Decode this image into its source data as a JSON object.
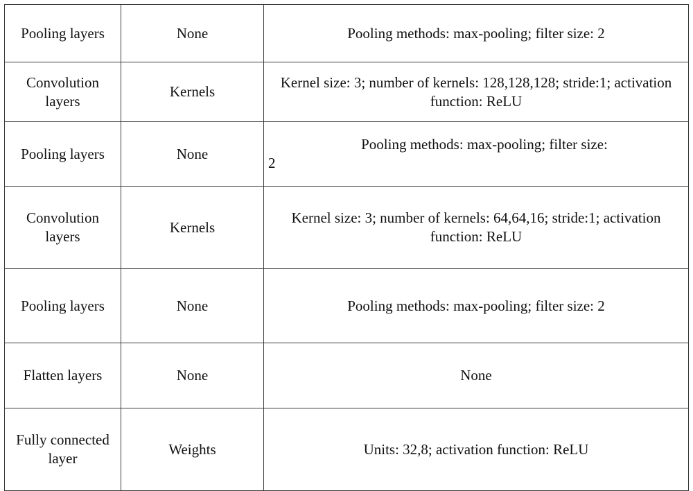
{
  "table": {
    "columns": [
      {
        "key": "layer",
        "name": "layer-type-column"
      },
      {
        "key": "param",
        "name": "parameter-column"
      },
      {
        "key": "detail",
        "name": "detail-column"
      }
    ],
    "rows": [
      {
        "layer": "Pooling layers",
        "param": "None",
        "detail": "Pooling methods: max-pooling; filter size: 2"
      },
      {
        "layer": "Convolution layers",
        "param": "Kernels",
        "detail": "Kernel size: 3; number of kernels: 128,128,128; stride:1; activation function: ReLU"
      },
      {
        "layer": "Pooling layers",
        "param": "None",
        "detail": "Pooling methods: max-pooling; filter size: 2",
        "detail_line_1": "Pooling methods: max-pooling; filter size:",
        "detail_line_2": "2"
      },
      {
        "layer": "Convolution layers",
        "param": "Kernels",
        "detail": "Kernel size: 3; number of kernels: 64,64,16; stride:1; activation function: ReLU"
      },
      {
        "layer": "Pooling layers",
        "param": "None",
        "detail": "Pooling methods: max-pooling; filter size: 2"
      },
      {
        "layer": "Flatten layers",
        "param": "None",
        "detail": "None"
      },
      {
        "layer": "Fully connected layer",
        "param": "Weights",
        "detail": "Units: 32,8; activation function: ReLU"
      }
    ]
  },
  "style": {
    "border_color": "#3a3a3a",
    "text_color": "#111111",
    "background": "#ffffff"
  }
}
